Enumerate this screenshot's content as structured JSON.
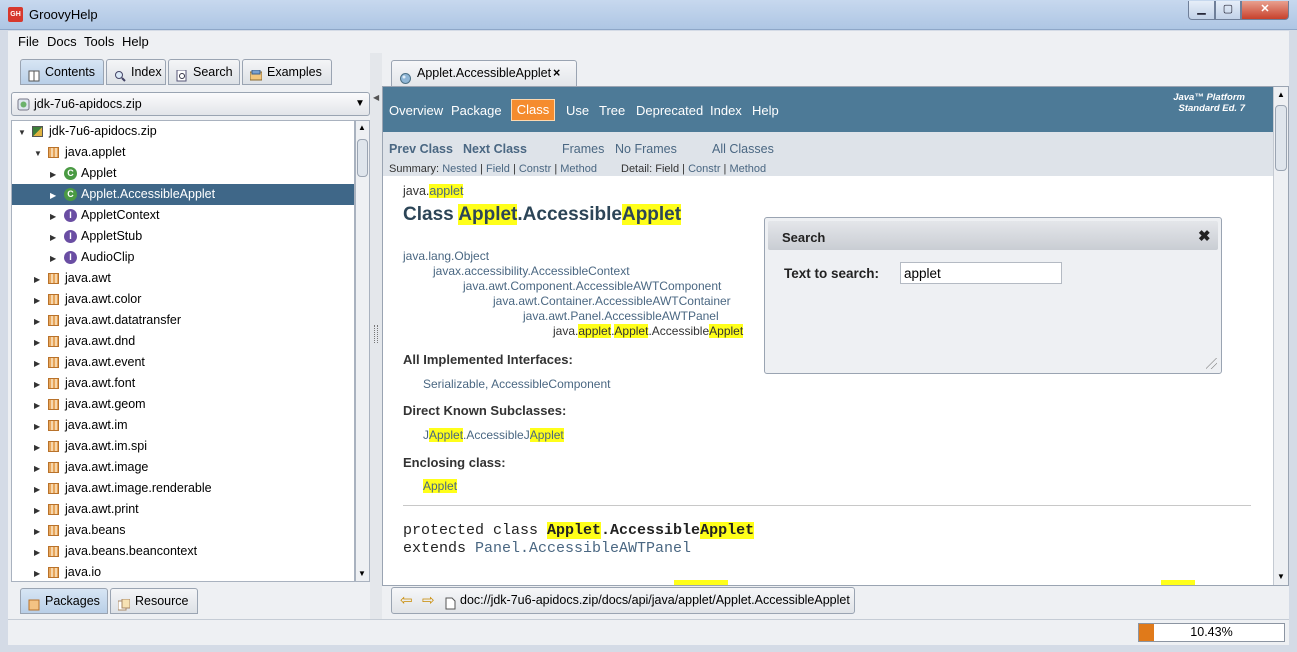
{
  "window": {
    "title": "GroovyHelp",
    "icon_text": "GH",
    "min": "▁",
    "max": "▢",
    "close": "✕"
  },
  "menu": [
    "File",
    "Docs",
    "Tools",
    "Help"
  ],
  "left_tabs": {
    "contents": "Contents",
    "index": "Index",
    "search": "Search",
    "examples": "Examples"
  },
  "combo": {
    "value": "jdk-7u6-apidocs.zip",
    "arrow": "▼"
  },
  "tree": [
    {
      "label": "jdk-7u6-apidocs.zip",
      "depth": 0,
      "toggle": "▼",
      "icon": "zip"
    },
    {
      "label": "java.applet",
      "depth": 1,
      "toggle": "▼",
      "icon": "pkg"
    },
    {
      "label": "Applet",
      "depth": 2,
      "toggle": "▶",
      "icon": "class"
    },
    {
      "label": "Applet.AccessibleApplet",
      "depth": 2,
      "toggle": "▶",
      "icon": "class",
      "selected": true
    },
    {
      "label": "AppletContext",
      "depth": 2,
      "toggle": "▶",
      "icon": "interface"
    },
    {
      "label": "AppletStub",
      "depth": 2,
      "toggle": "▶",
      "icon": "interface"
    },
    {
      "label": "AudioClip",
      "depth": 2,
      "toggle": "▶",
      "icon": "interface"
    },
    {
      "label": "java.awt",
      "depth": 1,
      "toggle": "▶",
      "icon": "pkg"
    },
    {
      "label": "java.awt.color",
      "depth": 1,
      "toggle": "▶",
      "icon": "pkg"
    },
    {
      "label": "java.awt.datatransfer",
      "depth": 1,
      "toggle": "▶",
      "icon": "pkg"
    },
    {
      "label": "java.awt.dnd",
      "depth": 1,
      "toggle": "▶",
      "icon": "pkg"
    },
    {
      "label": "java.awt.event",
      "depth": 1,
      "toggle": "▶",
      "icon": "pkg"
    },
    {
      "label": "java.awt.font",
      "depth": 1,
      "toggle": "▶",
      "icon": "pkg"
    },
    {
      "label": "java.awt.geom",
      "depth": 1,
      "toggle": "▶",
      "icon": "pkg"
    },
    {
      "label": "java.awt.im",
      "depth": 1,
      "toggle": "▶",
      "icon": "pkg"
    },
    {
      "label": "java.awt.im.spi",
      "depth": 1,
      "toggle": "▶",
      "icon": "pkg"
    },
    {
      "label": "java.awt.image",
      "depth": 1,
      "toggle": "▶",
      "icon": "pkg"
    },
    {
      "label": "java.awt.image.renderable",
      "depth": 1,
      "toggle": "▶",
      "icon": "pkg"
    },
    {
      "label": "java.awt.print",
      "depth": 1,
      "toggle": "▶",
      "icon": "pkg"
    },
    {
      "label": "java.beans",
      "depth": 1,
      "toggle": "▶",
      "icon": "pkg"
    },
    {
      "label": "java.beans.beancontext",
      "depth": 1,
      "toggle": "▶",
      "icon": "pkg"
    },
    {
      "label": "java.io",
      "depth": 1,
      "toggle": "▶",
      "icon": "pkg"
    }
  ],
  "bottom_tabs": {
    "packages": "Packages",
    "resource": "Resource"
  },
  "doc_tab": {
    "label": "Applet.AccessibleApplet",
    "close": "×"
  },
  "navbar": {
    "overview": "Overview",
    "package": "Package",
    "class": "Class",
    "use": "Use",
    "tree": "Tree",
    "deprecated": "Deprecated",
    "index": "Index",
    "help": "Help",
    "platform_1": "Java™ Platform",
    "platform_2": "Standard Ed. 7"
  },
  "subnav": {
    "prev": "Prev Class",
    "next": "Next Class",
    "frames": "Frames",
    "noframes": "No Frames",
    "all": "All Classes",
    "summary_label": "Summary:",
    "nested": "Nested",
    "field": "Field",
    "constr": "Constr",
    "method": "Method",
    "detail_label": "Detail:",
    "d_field": "Field",
    "d_constr": "Constr",
    "d_method": "Method",
    "sep": "|"
  },
  "content": {
    "pkg_prefix": "java.",
    "pkg_hl": "applet",
    "title_prefix": "Class ",
    "title_hl1": "Applet",
    "title_mid": ".Accessible",
    "title_hl2": "Applet",
    "h1": "java.lang.Object",
    "h2": "javax.accessibility.AccessibleContext",
    "h3": "java.awt.Component.AccessibleAWTComponent",
    "h4": "java.awt.Container.AccessibleAWTContainer",
    "h5": "java.awt.Panel.AccessibleAWTPanel",
    "h6_a": "java.",
    "h6_b": "applet",
    "h6_c": ".",
    "h6_d": "Applet",
    "h6_e": ".Accessible",
    "h6_f": "Applet",
    "impl_title": "All Implemented Interfaces:",
    "impl_1": "Serializable",
    "impl_sep": ", ",
    "impl_2": "AccessibleComponent",
    "sub_title": "Direct Known Subclasses:",
    "sub_a": "J",
    "sub_b": "Applet",
    "sub_c": ".AccessibleJ",
    "sub_d": "Applet",
    "enc_title": "Enclosing class:",
    "enc_val": "Applet",
    "code1_a": "protected class ",
    "code1_b": "Applet",
    "code1_c": ".Accessible",
    "code1_d": "Applet",
    "code2_a": "extends ",
    "code2_b": "Panel.AccessibleAWTPanel"
  },
  "search": {
    "title": "Search",
    "close": "✖",
    "label": "Text to search:",
    "value": "applet"
  },
  "address": {
    "back": "⇦",
    "forward": "⇨",
    "url": "doc://jdk-7u6-apidocs.zip/docs/api/java/applet/Applet.AccessibleApplet"
  },
  "status": {
    "progress_text": "10.43%",
    "progress_value": 0.1043
  },
  "colors": {
    "navbar": "#4d7a97",
    "active_nav": "#f58c2e",
    "highlight": "#ffff1a",
    "selection": "#3f6788",
    "progress": "#e07a1a"
  }
}
